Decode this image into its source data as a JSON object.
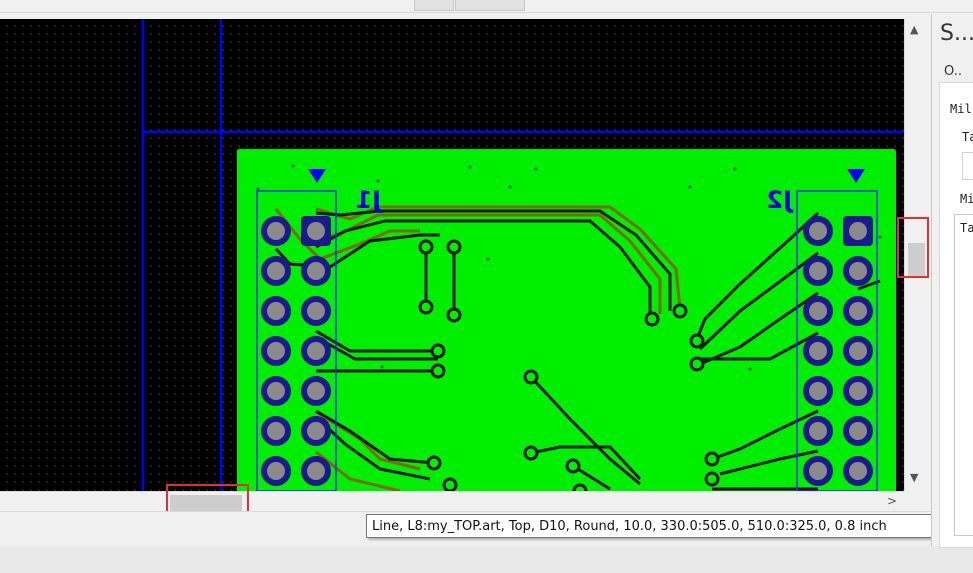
{
  "pcb": {
    "left_connector_label": "J1",
    "right_connector_label": "J2",
    "colors": {
      "background": "#000000",
      "grid_dot": "#7a7a7a",
      "board_outline": "#0000ff",
      "copper_fill": "#00ee00",
      "trace": "#1a1a1a",
      "trace_bottom": "#7a6a10",
      "pad": "#1a1a8c",
      "pad_drill": "#8a8a8a",
      "connector_outline": "#2a2aff"
    }
  },
  "side_panel": {
    "title": "S...",
    "tab": "O..",
    "label_1": "Mil",
    "label_2": "Ta",
    "label_3": "Mi",
    "text_box": "Ta"
  },
  "tooltip": {
    "text": "Line, L8:my_TOP.art, Top, D10, Round, 10.0, 330.0:505.0, 510.0:325.0, 0.8 inch"
  },
  "icons": {
    "scroll_up": "chevron-up-icon",
    "scroll_down": "chevron-down-icon",
    "scroll_right": "chevron-right-icon"
  }
}
